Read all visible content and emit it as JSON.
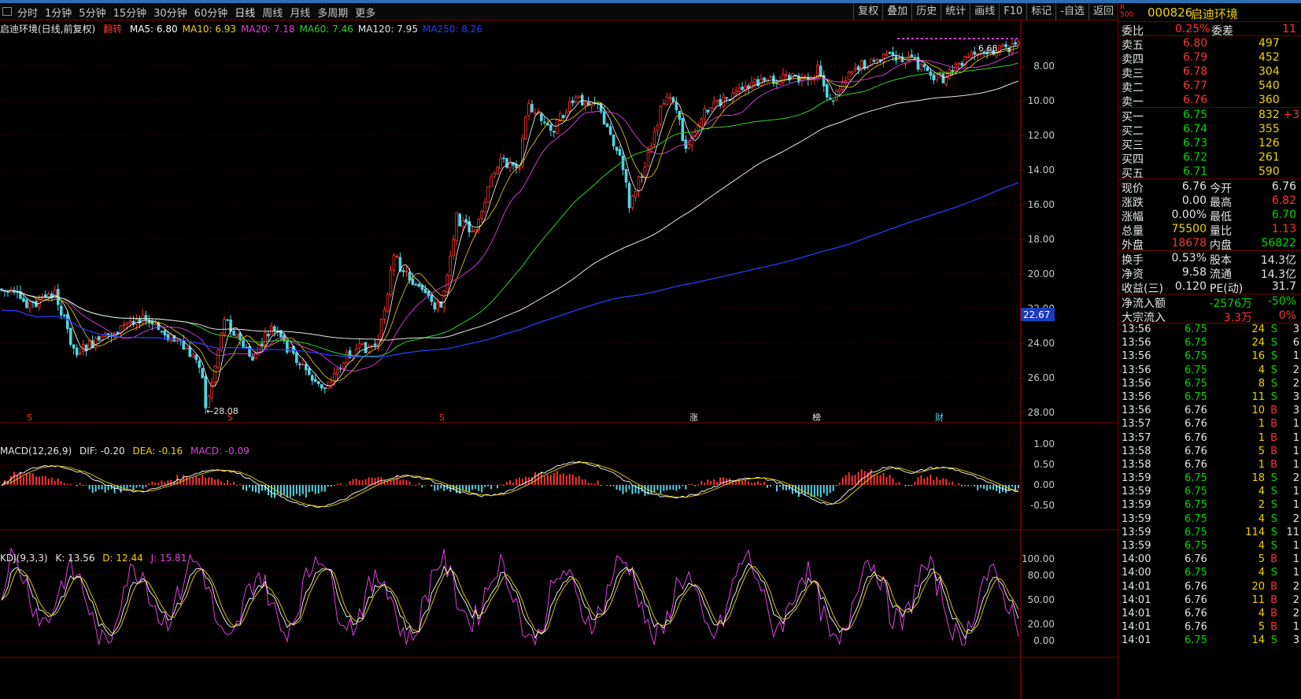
{
  "toolbar": {
    "tabs": [
      "分时",
      "1分钟",
      "5分钟",
      "15分钟",
      "30分钟",
      "60分钟",
      "日线",
      "周线",
      "月线",
      "多周期",
      "更多"
    ],
    "active_tab": "日线",
    "buttons": [
      "复权",
      "叠加",
      "历史",
      "统计",
      "画线",
      "F10",
      "标记",
      "-自选",
      "返回"
    ]
  },
  "chart": {
    "title": "启迪环境(日线,前复权)",
    "signal": "翻转",
    "ma": [
      {
        "label": "MA5: 6.80",
        "color": "#ffffff"
      },
      {
        "label": "MA10: 6.93",
        "color": "#f0d400"
      },
      {
        "label": "MA20: 7.18",
        "color": "#e040e0"
      },
      {
        "label": "MA60: 7.46",
        "color": "#30d030"
      },
      {
        "label": "MA120: 7.95",
        "color": "#e6e6e6"
      },
      {
        "label": "MA250: 8.26",
        "color": "#2a3cff"
      }
    ],
    "price_axis": [
      "8.00",
      "10.00",
      "12.00",
      "14.00",
      "16.00",
      "18.00",
      "20.00",
      "22.00",
      "24.00",
      "26.00",
      "28.00"
    ],
    "current_price_tag": "22.67",
    "low_annotation": "28.08",
    "high_annotation": "6.68",
    "event_markers": [
      "S",
      "S",
      "S",
      "涨",
      "榜",
      "财"
    ],
    "macd": {
      "title": "MACD(12,26,9)",
      "dif": "DIF: -0.20",
      "dea": "DEA: -0.16",
      "macd": "MACD: -0.09",
      "axis": [
        "1.00",
        "0.50",
        "0.00",
        "-0.50"
      ]
    },
    "kdj": {
      "title": "KDJ(9,3,3)",
      "k": "K: 13.56",
      "d": "D: 12.44",
      "j": "J: 15.81",
      "axis": [
        "100.00",
        "80.00",
        "50.00",
        "20.00",
        "0.00"
      ]
    },
    "colors": {
      "up": "#ff3232",
      "down": "#54d4e4",
      "ma250": "#2a3cff",
      "ma60": "#30d030",
      "ma20": "#e040e0",
      "ma10": "#f0d400"
    }
  },
  "quote": {
    "code": "000826",
    "name": "启迪环境",
    "badge_top": "R",
    "badge_bottom": "500",
    "weibi_label": "委比",
    "weibi_value": "0.25%",
    "weicha_label": "委差",
    "weicha_value": "11",
    "asks": [
      {
        "label": "卖五",
        "price": "6.80",
        "vol": "497"
      },
      {
        "label": "卖四",
        "price": "6.79",
        "vol": "452"
      },
      {
        "label": "卖三",
        "price": "6.78",
        "vol": "304"
      },
      {
        "label": "卖二",
        "price": "6.77",
        "vol": "540"
      },
      {
        "label": "卖一",
        "price": "6.76",
        "vol": "360"
      }
    ],
    "bids": [
      {
        "label": "买一",
        "price": "6.75",
        "vol": "832",
        "chg": "+3"
      },
      {
        "label": "买二",
        "price": "6.74",
        "vol": "355",
        "chg": ""
      },
      {
        "label": "买三",
        "price": "6.73",
        "vol": "126",
        "chg": ""
      },
      {
        "label": "买四",
        "price": "6.72",
        "vol": "261",
        "chg": ""
      },
      {
        "label": "买五",
        "price": "6.71",
        "vol": "590",
        "chg": ""
      }
    ],
    "stats": [
      {
        "l1": "现价",
        "v1": "6.76",
        "l2": "今开",
        "v2": "6.76",
        "c1": "white",
        "c2": "white"
      },
      {
        "l1": "涨跌",
        "v1": "0.00",
        "l2": "最高",
        "v2": "6.82",
        "c1": "white",
        "c2": "red"
      },
      {
        "l1": "涨幅",
        "v1": "0.00%",
        "l2": "最低",
        "v2": "6.70",
        "c1": "white",
        "c2": "green"
      },
      {
        "l1": "总量",
        "v1": "75500",
        "l2": "量比",
        "v2": "1.13",
        "c1": "yellow",
        "c2": "red"
      },
      {
        "l1": "外盘",
        "v1": "18678",
        "l2": "内盘",
        "v2": "56822",
        "c1": "red",
        "c2": "green"
      }
    ],
    "stats2": [
      {
        "l1": "换手",
        "v1": "0.53%",
        "l2": "股本",
        "v2": "14.3亿"
      },
      {
        "l1": "净资",
        "v1": "9.58",
        "l2": "流通",
        "v2": "14.3亿"
      },
      {
        "l1": "收益(三)",
        "v1": "0.120",
        "l2": "PE(动)",
        "v2": "31.7"
      }
    ],
    "flow": [
      {
        "label": "净流入额",
        "v1": "-2576万",
        "v2": "-50%",
        "c1": "green",
        "c2": "green"
      },
      {
        "label": "大宗流入",
        "v1": "3.3万",
        "v2": "0%",
        "c1": "red",
        "c2": "red"
      }
    ],
    "ticks": [
      [
        "13:56",
        "6.75",
        "24",
        "S",
        "3"
      ],
      [
        "13:56",
        "6.75",
        "24",
        "S",
        "6"
      ],
      [
        "13:56",
        "6.75",
        "16",
        "S",
        "1"
      ],
      [
        "13:56",
        "6.75",
        "4",
        "S",
        "2"
      ],
      [
        "13:56",
        "6.75",
        "8",
        "S",
        "2"
      ],
      [
        "13:56",
        "6.75",
        "11",
        "S",
        "3"
      ],
      [
        "13:56",
        "6.76",
        "10",
        "B",
        "3"
      ],
      [
        "13:57",
        "6.76",
        "1",
        "B",
        "1"
      ],
      [
        "13:57",
        "6.76",
        "1",
        "B",
        "1"
      ],
      [
        "13:58",
        "6.76",
        "5",
        "B",
        "1"
      ],
      [
        "13:58",
        "6.76",
        "1",
        "B",
        "1"
      ],
      [
        "13:59",
        "6.75",
        "18",
        "S",
        "2"
      ],
      [
        "13:59",
        "6.75",
        "4",
        "S",
        "1"
      ],
      [
        "13:59",
        "6.75",
        "2",
        "S",
        "1"
      ],
      [
        "13:59",
        "6.75",
        "4",
        "S",
        "2"
      ],
      [
        "13:59",
        "6.75",
        "114",
        "S",
        "11"
      ],
      [
        "13:59",
        "6.75",
        "4",
        "S",
        "1"
      ],
      [
        "14:00",
        "6.76",
        "5",
        "B",
        "1"
      ],
      [
        "14:00",
        "6.75",
        "4",
        "S",
        "1"
      ],
      [
        "14:01",
        "6.76",
        "20",
        "B",
        "2"
      ],
      [
        "14:01",
        "6.76",
        "11",
        "B",
        "2"
      ],
      [
        "14:01",
        "6.76",
        "4",
        "B",
        "2"
      ],
      [
        "14:01",
        "6.76",
        "5",
        "B",
        "1"
      ],
      [
        "14:01",
        "6.75",
        "14",
        "S",
        "3"
      ]
    ]
  }
}
